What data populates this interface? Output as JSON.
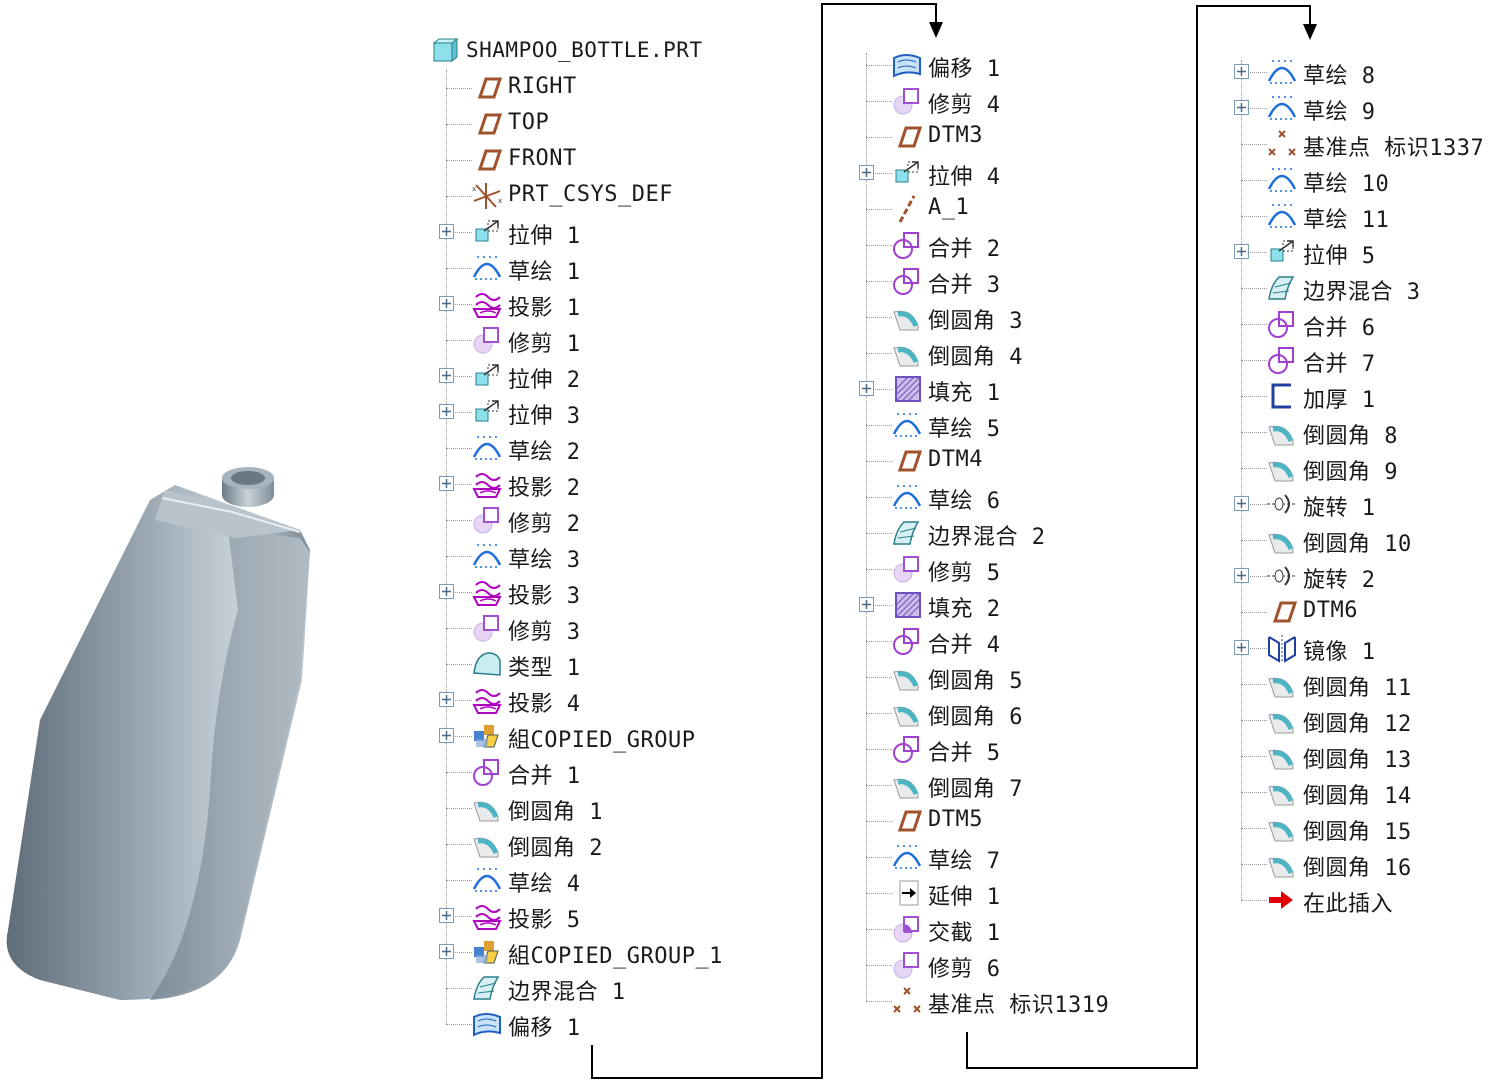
{
  "columns": [
    {
      "items": [
        {
          "label": "SHAMPOO_BOTTLE.PRT",
          "icon": "part-icon",
          "root": true
        },
        {
          "label": "RIGHT",
          "icon": "datum-plane-icon"
        },
        {
          "label": "TOP",
          "icon": "datum-plane-icon"
        },
        {
          "label": "FRONT",
          "icon": "datum-plane-icon"
        },
        {
          "label": "PRT_CSYS_DEF",
          "icon": "coordinate-system-icon"
        },
        {
          "label": "拉伸 1",
          "icon": "extrude-icon",
          "expandable": true
        },
        {
          "label": "草绘 1",
          "icon": "sketch-icon"
        },
        {
          "label": "投影 1",
          "icon": "projection-icon",
          "expandable": true
        },
        {
          "label": "修剪 1",
          "icon": "trim-icon"
        },
        {
          "label": "拉伸 2",
          "icon": "extrude-icon",
          "expandable": true
        },
        {
          "label": "拉伸 3",
          "icon": "extrude-icon",
          "expandable": true
        },
        {
          "label": "草绘 2",
          "icon": "sketch-icon"
        },
        {
          "label": "投影 2",
          "icon": "projection-icon",
          "expandable": true
        },
        {
          "label": "修剪 2",
          "icon": "trim-icon"
        },
        {
          "label": "草绘 3",
          "icon": "sketch-icon"
        },
        {
          "label": "投影 3",
          "icon": "projection-icon",
          "expandable": true
        },
        {
          "label": "修剪 3",
          "icon": "trim-icon"
        },
        {
          "label": "类型 1",
          "icon": "style-surface-icon"
        },
        {
          "label": "投影 4",
          "icon": "projection-icon",
          "expandable": true
        },
        {
          "label": "組COPIED_GROUP",
          "icon": "group-icon",
          "expandable": true
        },
        {
          "label": "合并 1",
          "icon": "merge-icon"
        },
        {
          "label": "倒圆角 1",
          "icon": "round-icon"
        },
        {
          "label": "倒圆角 2",
          "icon": "round-icon"
        },
        {
          "label": "草绘 4",
          "icon": "sketch-icon"
        },
        {
          "label": "投影 5",
          "icon": "projection-icon",
          "expandable": true
        },
        {
          "label": "組COPIED_GROUP_1",
          "icon": "group-icon",
          "expandable": true
        },
        {
          "label": "边界混合 1",
          "icon": "boundary-blend-icon"
        },
        {
          "label": "偏移 1",
          "icon": "offset-icon"
        }
      ]
    },
    {
      "items": [
        {
          "label": "偏移 1",
          "icon": "offset-icon"
        },
        {
          "label": "修剪 4",
          "icon": "trim-icon"
        },
        {
          "label": "DTM3",
          "icon": "datum-plane-icon"
        },
        {
          "label": "拉伸 4",
          "icon": "extrude-icon",
          "expandable": true
        },
        {
          "label": "A_1",
          "icon": "datum-axis-icon"
        },
        {
          "label": "合并 2",
          "icon": "merge-icon"
        },
        {
          "label": "合并 3",
          "icon": "merge-icon"
        },
        {
          "label": "倒圆角 3",
          "icon": "round-icon"
        },
        {
          "label": "倒圆角 4",
          "icon": "round-icon"
        },
        {
          "label": "填充 1",
          "icon": "fill-icon",
          "expandable": true
        },
        {
          "label": "草绘 5",
          "icon": "sketch-icon"
        },
        {
          "label": "DTM4",
          "icon": "datum-plane-icon"
        },
        {
          "label": "草绘 6",
          "icon": "sketch-icon"
        },
        {
          "label": "边界混合 2",
          "icon": "boundary-blend-icon"
        },
        {
          "label": "修剪 5",
          "icon": "trim-icon"
        },
        {
          "label": "填充 2",
          "icon": "fill-icon",
          "expandable": true
        },
        {
          "label": "合并 4",
          "icon": "merge-icon"
        },
        {
          "label": "倒圆角 5",
          "icon": "round-icon"
        },
        {
          "label": "倒圆角 6",
          "icon": "round-icon"
        },
        {
          "label": "合并 5",
          "icon": "merge-icon"
        },
        {
          "label": "倒圆角 7",
          "icon": "round-icon"
        },
        {
          "label": "DTM5",
          "icon": "datum-plane-icon"
        },
        {
          "label": "草绘 7",
          "icon": "sketch-icon"
        },
        {
          "label": "延伸 1",
          "icon": "extend-icon"
        },
        {
          "label": "交截 1",
          "icon": "intersect-icon"
        },
        {
          "label": "修剪 6",
          "icon": "trim-icon"
        },
        {
          "label": "基准点 标识1319",
          "icon": "datum-point-icon"
        }
      ]
    },
    {
      "items": [
        {
          "label": "草绘 8",
          "icon": "sketch-icon",
          "expandable": true
        },
        {
          "label": "草绘 9",
          "icon": "sketch-icon",
          "expandable": true
        },
        {
          "label": "基准点 标识1337",
          "icon": "datum-point-icon"
        },
        {
          "label": "草绘 10",
          "icon": "sketch-icon"
        },
        {
          "label": "草绘 11",
          "icon": "sketch-icon"
        },
        {
          "label": "拉伸 5",
          "icon": "extrude-icon",
          "expandable": true
        },
        {
          "label": "边界混合 3",
          "icon": "boundary-blend-icon"
        },
        {
          "label": "合并 6",
          "icon": "merge-icon"
        },
        {
          "label": "合并 7",
          "icon": "merge-icon"
        },
        {
          "label": "加厚 1",
          "icon": "thicken-icon"
        },
        {
          "label": "倒圆角 8",
          "icon": "round-icon"
        },
        {
          "label": "倒圆角 9",
          "icon": "round-icon"
        },
        {
          "label": "旋转 1",
          "icon": "revolve-icon",
          "expandable": true
        },
        {
          "label": "倒圆角 10",
          "icon": "round-icon"
        },
        {
          "label": "旋转 2",
          "icon": "revolve-icon",
          "expandable": true
        },
        {
          "label": "DTM6",
          "icon": "datum-plane-icon"
        },
        {
          "label": "镜像 1",
          "icon": "mirror-icon",
          "expandable": true
        },
        {
          "label": "倒圆角 11",
          "icon": "round-icon"
        },
        {
          "label": "倒圆角 12",
          "icon": "round-icon"
        },
        {
          "label": "倒圆角 13",
          "icon": "round-icon"
        },
        {
          "label": "倒圆角 14",
          "icon": "round-icon"
        },
        {
          "label": "倒圆角 15",
          "icon": "round-icon"
        },
        {
          "label": "倒圆角 16",
          "icon": "round-icon"
        },
        {
          "label": "在此插入",
          "icon": "insert-here-arrow-icon"
        }
      ]
    }
  ],
  "colors": {
    "datum_plane": "#a0522d",
    "sketch": "#1e6fd9",
    "projection": "#b000c0",
    "trim": "#a050d0",
    "merge": "#a040d0",
    "round": "#5aa0b0",
    "fill": "#7050c0",
    "insert_arrow": "#e00000",
    "tree_line": "#9a9a9a",
    "bottle": "#8a9aa6"
  }
}
